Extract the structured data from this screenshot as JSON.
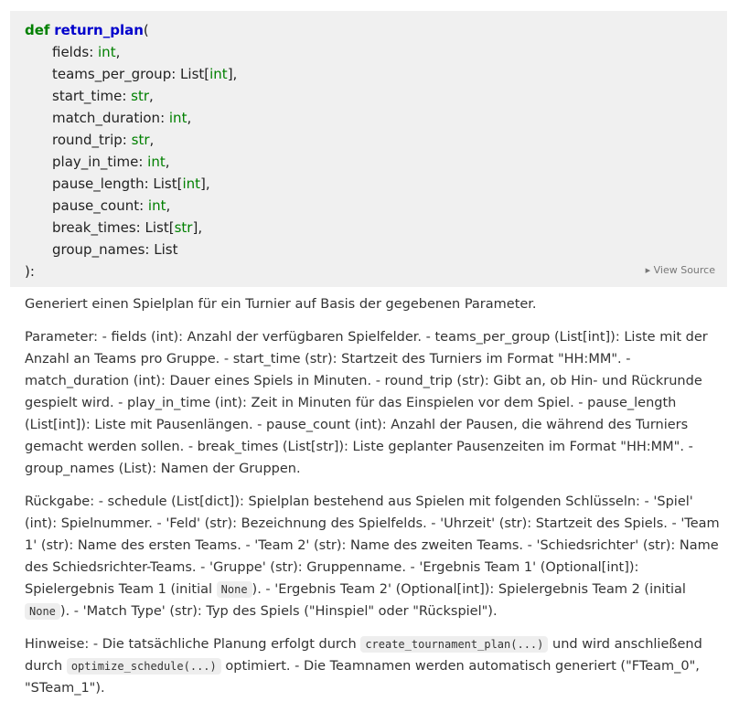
{
  "signature": {
    "keyword": "def",
    "name": "return_plan",
    "open": "(",
    "close": "):",
    "params": [
      {
        "name": "fields",
        "type_prefix": "",
        "type": "int",
        "type_suffix": ""
      },
      {
        "name": "teams_per_group",
        "type_prefix": "List[",
        "type": "int",
        "type_suffix": "]"
      },
      {
        "name": "start_time",
        "type_prefix": "",
        "type": "str",
        "type_suffix": ""
      },
      {
        "name": "match_duration",
        "type_prefix": "",
        "type": "int",
        "type_suffix": ""
      },
      {
        "name": "round_trip",
        "type_prefix": "",
        "type": "str",
        "type_suffix": ""
      },
      {
        "name": "play_in_time",
        "type_prefix": "",
        "type": "int",
        "type_suffix": ""
      },
      {
        "name": "pause_length",
        "type_prefix": "List[",
        "type": "int",
        "type_suffix": "]"
      },
      {
        "name": "pause_count",
        "type_prefix": "",
        "type": "int",
        "type_suffix": ""
      },
      {
        "name": "break_times",
        "type_prefix": "List[",
        "type": "str",
        "type_suffix": "]"
      },
      {
        "name": "group_names",
        "type_prefix": "List",
        "type": "",
        "type_suffix": ""
      }
    ],
    "view_source": "▸ View Source"
  },
  "doc": {
    "summary": "Generiert einen Spielplan für ein Turnier auf Basis der gegebenen Parameter.",
    "parameters": "Parameter: - fields (int): Anzahl der verfügbaren Spielfelder. - teams_per_group (List[int]): Liste mit der Anzahl an Teams pro Gruppe. - start_time (str): Startzeit des Turniers im Format \"HH:MM\". - match_duration (int): Dauer eines Spiels in Minuten. - round_trip (str): Gibt an, ob Hin- und Rückrunde gespielt wird. - play_in_time (int): Zeit in Minuten für das Einspielen vor dem Spiel. - pause_length (List[int]): Liste mit Pausenlängen. - pause_count (int): Anzahl der Pausen, die während des Turniers gemacht werden sollen. - break_times (List[str]): Liste geplanter Pausenzeiten im Format \"HH:MM\". - group_names (List): Namen der Gruppen.",
    "returns": {
      "part1": "Rückgabe: - schedule (List[dict]): Spielplan bestehend aus Spielen mit folgenden Schlüsseln: - 'Spiel' (int): Spielnummer. - 'Feld' (str): Bezeichnung des Spielfelds. - 'Uhrzeit' (str): Startzeit des Spiels. - 'Team 1' (str): Name des ersten Teams. - 'Team 2' (str): Name des zweiten Teams. - 'Schiedsrichter' (str): Name des Schiedsrichter-Teams. - 'Gruppe' (str): Gruppenname. - 'Ergebnis Team 1' (Optional[int]): Spielergebnis Team 1 (initial ",
      "code1": "None",
      "part2": "). - 'Ergebnis Team 2' (Optional[int]): Spielergebnis Team 2 (initial ",
      "code2": "None",
      "part3": "). - 'Match Type' (str): Typ des Spiels (\"Hinspiel\" oder \"Rückspiel\")."
    },
    "notes": {
      "part1": "Hinweise: - Die tatsächliche Planung erfolgt durch ",
      "code1": "create_tournament_plan(...)",
      "part2": " und wird anschließend durch ",
      "code2": "optimize_schedule(...)",
      "part3": " optimiert. - Die Teamnamen werden automatisch generiert (\"FTeam_0\", \"STeam_1\")."
    }
  }
}
